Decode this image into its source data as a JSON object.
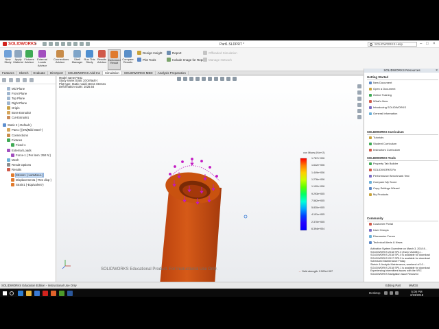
{
  "titlebar": {
    "app_name": "SOLIDWORKS",
    "document_title": "Part1.SLDPRT *",
    "search_placeholder": "SOLIDWORKS Help"
  },
  "ribbon": {
    "buttons": [
      {
        "label": "New Study",
        "icon": "study-icon"
      },
      {
        "label": "Apply Material",
        "icon": "material-icon"
      },
      {
        "label": "Fixtures Advisor",
        "icon": "fixture-icon"
      },
      {
        "label": "External Loads Advisor",
        "icon": "load-icon"
      },
      {
        "label": "Connections Advisor",
        "icon": "connection-icon"
      },
      {
        "label": "Shell Manager",
        "icon": "shell-icon"
      },
      {
        "label": "Run This Study",
        "icon": "run-icon"
      },
      {
        "label": "Results Advisor",
        "icon": "results-icon"
      },
      {
        "label": "Deformed Result",
        "icon": "deformed-icon"
      },
      {
        "label": "Compare Results",
        "icon": "compare-icon"
      }
    ],
    "small_buttons": [
      {
        "label": "Design Insight",
        "icon": "insight-icon"
      },
      {
        "label": "Plot Tools",
        "icon": "plot-tools-icon"
      },
      {
        "label": "Report",
        "icon": "report-icon"
      },
      {
        "label": "Include Image for Report",
        "icon": "image-report-icon"
      },
      {
        "label": "Offloaded Simulation",
        "icon": "offload-icon"
      },
      {
        "label": "Manage Network",
        "icon": "network-icon"
      }
    ]
  },
  "command_tabs": [
    "Features",
    "Sketch",
    "Evaluate",
    "DimXpert",
    "SOLIDWORKS Add-Ins",
    "Simulation",
    "SOLIDWORKS MBD",
    "Analysis Preparation"
  ],
  "active_command_tab": "Simulation",
  "tree": {
    "items": [
      {
        "label": "Mid Plane",
        "depth": 1,
        "icon": "plane-icon"
      },
      {
        "label": "Front Plane",
        "depth": 1,
        "icon": "plane-icon"
      },
      {
        "label": "Top Plane",
        "depth": 1,
        "icon": "plane-icon"
      },
      {
        "label": "Right Plane",
        "depth": 1,
        "icon": "plane-icon"
      },
      {
        "label": "Origin",
        "depth": 1,
        "icon": "origin-icon"
      },
      {
        "label": "Boss-Extrude2",
        "depth": 1,
        "icon": "extrude-icon"
      },
      {
        "label": "Cut-Extrude1",
        "depth": 1,
        "icon": "cut-icon"
      },
      {
        "label": "Static 2 (-Default-)",
        "depth": 0,
        "icon": "study-icon"
      },
      {
        "label": "Part1 (-[SW]Mild Steel-)",
        "depth": 1,
        "icon": "part-icon"
      },
      {
        "label": "Connections",
        "depth": 1,
        "icon": "connection-icon"
      },
      {
        "label": "Fixtures",
        "depth": 1,
        "icon": "fixture-icon"
      },
      {
        "label": "Fixed-1",
        "depth": 2,
        "icon": "fixture-icon"
      },
      {
        "label": "External Loads",
        "depth": 1,
        "icon": "load-icon"
      },
      {
        "label": "Force-1 (:Per item: 250 N:)",
        "depth": 2,
        "icon": "load-icon"
      },
      {
        "label": "Mesh",
        "depth": 1,
        "icon": "mesh-icon"
      },
      {
        "label": "Result Options",
        "depth": 1,
        "icon": "options-icon"
      },
      {
        "label": "Results",
        "depth": 1,
        "icon": "results-icon"
      },
      {
        "label": "Stress1 (-vonMises-)",
        "depth": 2,
        "icon": "plot-icon",
        "selected": true
      },
      {
        "label": "Displacement1 (-Res disp-)",
        "depth": 2,
        "icon": "plot-icon"
      },
      {
        "label": "Strain1 (-Equivalent-)",
        "depth": 2,
        "icon": "plot-icon"
      }
    ]
  },
  "viewport": {
    "info_lines": [
      "Model name:Part1",
      "Study name:Static 2(-Default-)",
      "Plot type: Static nodal stress Stress1",
      "Deformation scale: 1025.54"
    ],
    "watermark": "SOLIDWORKS Educational Product. For Instructional Use Only.",
    "legend": {
      "title": "von Mises (N/m^2)",
      "values": [
        "1.787e+006",
        "1.622e+006",
        "1.449e+006",
        "1.276e+006",
        "1.102e+006",
        "9.293e+005",
        "7.562e+005",
        "5.830e+005",
        "4.101e+005",
        "2.370e+005",
        "6.394e+004"
      ],
      "colors": [
        "#ff0000",
        "#ff7f00",
        "#ffd000",
        "#c8ff00",
        "#5cff00",
        "#00ff66",
        "#00ffd9",
        "#00a8ff",
        "#0040ff",
        "#2400ff",
        "#0000ff"
      ],
      "yield_label": "Yield strength: 2.500e+007",
      "yield_arrow": "→"
    },
    "model_color": "#c94c12"
  },
  "bottom_tabs": [
    "Model",
    "3D Views",
    "Motion Study 1",
    "Static 1",
    "Static 2"
  ],
  "bottom_tab_markers": [
    "",
    "",
    "",
    "",
    ""
  ],
  "active_bottom_tab": "Static 2",
  "status": {
    "left": "SOLIDWORKS Education Edition - Instructional Use Only",
    "editing": "Editing Part",
    "units": "MMGS"
  },
  "resources": {
    "title": "SOLIDWORKS Resources",
    "pin": "×",
    "sections": [
      {
        "title": "Getting Started",
        "items": [
          "New Document",
          "Open a Document",
          "Online Training",
          "What's New",
          "Introducing SOLIDWORKS",
          "General Information"
        ]
      },
      {
        "title": "SOLIDWORKS Curriculum",
        "items": [
          "Tutorials",
          "Student Curriculum",
          "Instructors Curriculum"
        ]
      },
      {
        "title": "SOLIDWORKS Tools",
        "items": [
          "Property Tab Builder",
          "SOLIDWORKS Rx",
          "Performance Benchmark Test",
          "Compare My Score",
          "Copy Settings Wizard",
          "My Products"
        ]
      },
      {
        "title": "Community",
        "items": [
          "Customer Portal",
          "User Groups",
          "Discussion Forum",
          "Technical Alerts & News"
        ]
      }
    ],
    "news": [
      "Activation System Downtime on March 3, 2018 8...",
      "SOLIDWORKS 2018 SP2.0 (Early Visibility) i...",
      "SOLIDWORKS 2018 SP1.0 is available for download",
      "SOLIDWORKS 2017 SP5.0 is available for download",
      "Scheduled Maintenance Friday",
      "Sketch & Analytic Maintenance, weekend of 10...",
      "SOLIDWORKS 2018 SP0.1 is available for download",
      "Experiencing intermittent issues with the VRC",
      "SOLIDWORKS Navigation Issue Resolved"
    ]
  },
  "taskbar": {
    "desktop_label": "Desktop",
    "time": "5:08 PM",
    "date": "2/23/2018"
  }
}
